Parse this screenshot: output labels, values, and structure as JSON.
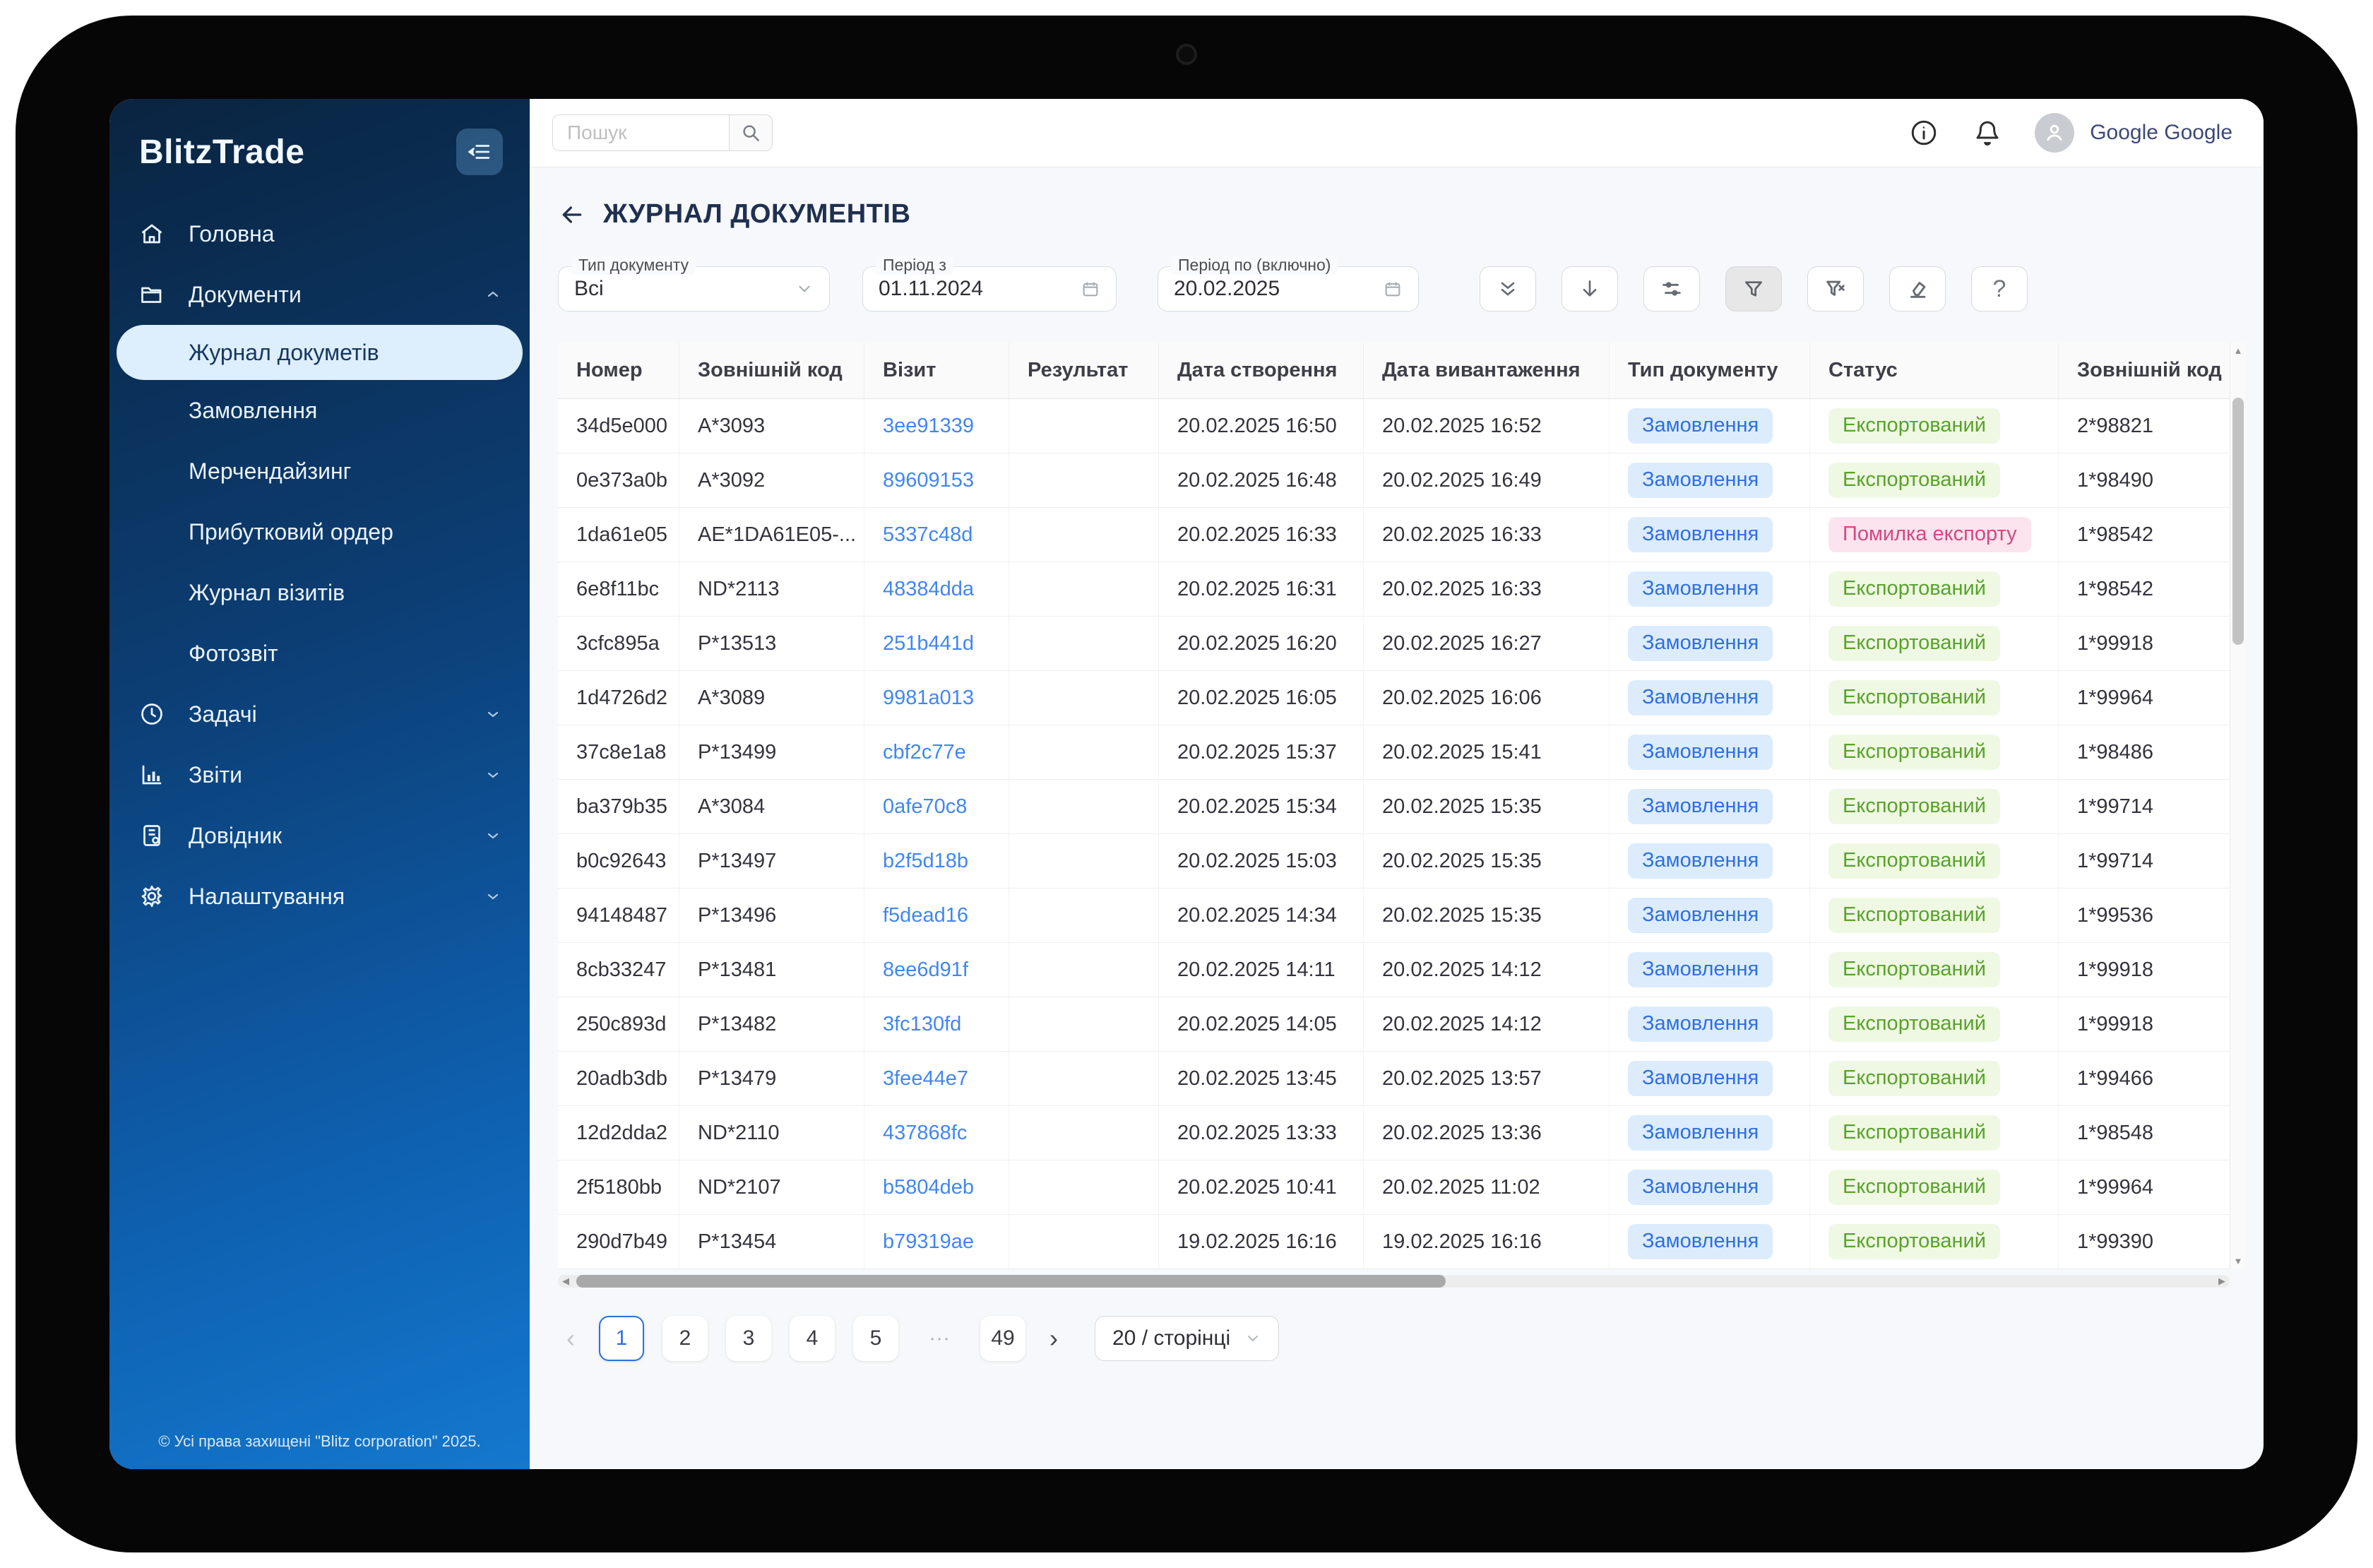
{
  "sidebar": {
    "logo": "BlitzTrade",
    "items": [
      {
        "label": "Головна"
      },
      {
        "label": "Документи"
      },
      {
        "label": "Задачі"
      },
      {
        "label": "Звіти"
      },
      {
        "label": "Довідник"
      },
      {
        "label": "Налаштування"
      }
    ],
    "documents_children": [
      {
        "label": "Журнал докуметів",
        "active": true
      },
      {
        "label": "Замовлення"
      },
      {
        "label": "Мерчендайзинг"
      },
      {
        "label": "Прибутковий ордер"
      },
      {
        "label": "Журнал візитів"
      },
      {
        "label": "Фотозвіт"
      }
    ],
    "footer": "© Усі права захищені \"Blitz corporation\" 2025."
  },
  "topbar": {
    "search_placeholder": "Пошук",
    "user_name": "Google Google"
  },
  "page": {
    "title": "ЖУРНАЛ ДОКУМЕНТІВ",
    "filters": {
      "doc_type": {
        "label": "Тип документу",
        "value": "Всі"
      },
      "period_from": {
        "label": "Період з",
        "value": "01.11.2024"
      },
      "period_to": {
        "label": "Період по (включно)",
        "value": "20.02.2025"
      }
    },
    "help_glyph": "?"
  },
  "glyphs": {
    "up": "▲",
    "down": "▼",
    "left": "◀",
    "right": "▶",
    "prev": "‹",
    "next": "›"
  },
  "table": {
    "headers": [
      "Номер",
      "Зовнішній код",
      "Візит",
      "Результат",
      "Дата створення",
      "Дата вивантаження",
      "Тип документу",
      "Статус",
      "Зовнішній код"
    ],
    "link_color": "#4186f1",
    "badges": {
      "order": {
        "label": "Замовлення",
        "bg": "#dcecfd",
        "color": "#2e6fe0"
      },
      "exported": {
        "label": "Експортований",
        "bg": "#eff8e3",
        "color": "#58a32a"
      },
      "export_error": {
        "label": "Помилка експорту",
        "bg": "#fce4ee",
        "color": "#d64682"
      }
    },
    "rows": [
      {
        "number": "34d5e000",
        "ext_code": "A*3093",
        "visit": "3ee91339",
        "result": "",
        "created": "20.02.2025 16:50",
        "uploaded": "20.02.2025 16:52",
        "doc_type": "order",
        "status": "exported",
        "ext_code2": "2*98821"
      },
      {
        "number": "0e373a0b",
        "ext_code": "A*3092",
        "visit": "89609153",
        "result": "",
        "created": "20.02.2025 16:48",
        "uploaded": "20.02.2025 16:49",
        "doc_type": "order",
        "status": "exported",
        "ext_code2": "1*98490"
      },
      {
        "number": "1da61e05",
        "ext_code": "AE*1DA61E05-...",
        "visit": "5337c48d",
        "result": "",
        "created": "20.02.2025 16:33",
        "uploaded": "20.02.2025 16:33",
        "doc_type": "order",
        "status": "export_error",
        "ext_code2": "1*98542"
      },
      {
        "number": "6e8f11bc",
        "ext_code": "ND*2113",
        "visit": "48384dda",
        "result": "",
        "created": "20.02.2025 16:31",
        "uploaded": "20.02.2025 16:33",
        "doc_type": "order",
        "status": "exported",
        "ext_code2": "1*98542"
      },
      {
        "number": "3cfc895a",
        "ext_code": "P*13513",
        "visit": "251b441d",
        "result": "",
        "created": "20.02.2025 16:20",
        "uploaded": "20.02.2025 16:27",
        "doc_type": "order",
        "status": "exported",
        "ext_code2": "1*99918"
      },
      {
        "number": "1d4726d2",
        "ext_code": "A*3089",
        "visit": "9981a013",
        "result": "",
        "created": "20.02.2025 16:05",
        "uploaded": "20.02.2025 16:06",
        "doc_type": "order",
        "status": "exported",
        "ext_code2": "1*99964"
      },
      {
        "number": "37c8e1a8",
        "ext_code": "P*13499",
        "visit": "cbf2c77e",
        "result": "",
        "created": "20.02.2025 15:37",
        "uploaded": "20.02.2025 15:41",
        "doc_type": "order",
        "status": "exported",
        "ext_code2": "1*98486"
      },
      {
        "number": "ba379b35",
        "ext_code": "A*3084",
        "visit": "0afe70c8",
        "result": "",
        "created": "20.02.2025 15:34",
        "uploaded": "20.02.2025 15:35",
        "doc_type": "order",
        "status": "exported",
        "ext_code2": "1*99714"
      },
      {
        "number": "b0c92643",
        "ext_code": "P*13497",
        "visit": "b2f5d18b",
        "result": "",
        "created": "20.02.2025 15:03",
        "uploaded": "20.02.2025 15:35",
        "doc_type": "order",
        "status": "exported",
        "ext_code2": "1*99714"
      },
      {
        "number": "94148487",
        "ext_code": "P*13496",
        "visit": "f5dead16",
        "result": "",
        "created": "20.02.2025 14:34",
        "uploaded": "20.02.2025 15:35",
        "doc_type": "order",
        "status": "exported",
        "ext_code2": "1*99536"
      },
      {
        "number": "8cb33247",
        "ext_code": "P*13481",
        "visit": "8ee6d91f",
        "result": "",
        "created": "20.02.2025 14:11",
        "uploaded": "20.02.2025 14:12",
        "doc_type": "order",
        "status": "exported",
        "ext_code2": "1*99918"
      },
      {
        "number": "250c893d",
        "ext_code": "P*13482",
        "visit": "3fc130fd",
        "result": "",
        "created": "20.02.2025 14:05",
        "uploaded": "20.02.2025 14:12",
        "doc_type": "order",
        "status": "exported",
        "ext_code2": "1*99918"
      },
      {
        "number": "20adb3db",
        "ext_code": "P*13479",
        "visit": "3fee44e7",
        "result": "",
        "created": "20.02.2025 13:45",
        "uploaded": "20.02.2025 13:57",
        "doc_type": "order",
        "status": "exported",
        "ext_code2": "1*99466"
      },
      {
        "number": "12d2dda2",
        "ext_code": "ND*2110",
        "visit": "437868fc",
        "result": "",
        "created": "20.02.2025 13:33",
        "uploaded": "20.02.2025 13:36",
        "doc_type": "order",
        "status": "exported",
        "ext_code2": "1*98548"
      },
      {
        "number": "2f5180bb",
        "ext_code": "ND*2107",
        "visit": "b5804deb",
        "result": "",
        "created": "20.02.2025 10:41",
        "uploaded": "20.02.2025 11:02",
        "doc_type": "order",
        "status": "exported",
        "ext_code2": "1*99964"
      },
      {
        "number": "290d7b49",
        "ext_code": "P*13454",
        "visit": "b79319ae",
        "result": "",
        "created": "19.02.2025 16:16",
        "uploaded": "19.02.2025 16:16",
        "doc_type": "order",
        "status": "exported",
        "ext_code2": "1*99390"
      }
    ]
  },
  "pagination": {
    "pages": [
      "1",
      "2",
      "3",
      "4",
      "5",
      "···",
      "49"
    ],
    "active_page": "1",
    "page_size_label": "20 / сторінці"
  }
}
